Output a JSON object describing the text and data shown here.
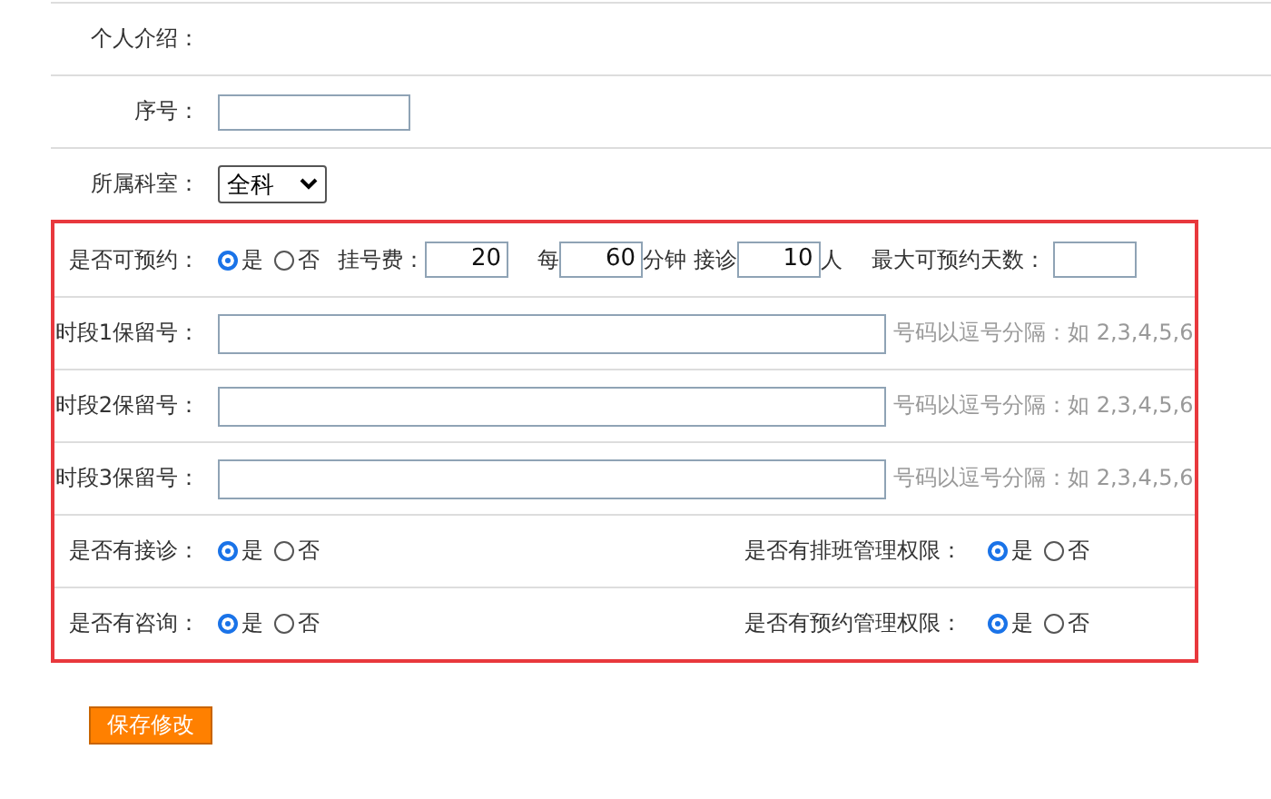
{
  "top_rows": [
    {
      "kind": "text",
      "label": "个人介绍："
    },
    {
      "kind": "input",
      "label": "序号："
    },
    {
      "kind": "select",
      "label": "所属科室：",
      "value": "全科"
    }
  ],
  "booking": {
    "label": "是否可预约：",
    "options": [
      {
        "label": "是",
        "selected": true
      },
      {
        "label": "否",
        "selected": false
      }
    ],
    "fee_label": "挂号费：",
    "fee": "20",
    "per_label": "每",
    "minutes": "60",
    "minutes_label": "分钟 接诊",
    "patients": "10",
    "patients_label": "人",
    "max_days_label": "最大可预约天数："
  },
  "reserve_rows": [
    {
      "label": "时段1保留号：",
      "hint": "号码以逗号分隔：如 2,3,4,5,6"
    },
    {
      "label": "时段2保留号：",
      "hint": "号码以逗号分隔：如 2,3,4,5,6"
    },
    {
      "label": "时段3保留号：",
      "hint": "号码以逗号分隔：如 2,3,4,5,6"
    }
  ],
  "permission_rows": [
    [
      {
        "label": "是否有接诊：",
        "options": [
          {
            "label": "是",
            "selected": true
          },
          {
            "label": "否",
            "selected": false
          }
        ]
      },
      {
        "label": "是否有排班管理权限：",
        "options": [
          {
            "label": "是",
            "selected": true
          },
          {
            "label": "否",
            "selected": false
          }
        ]
      }
    ],
    [
      {
        "label": "是否有咨询：",
        "options": [
          {
            "label": "是",
            "selected": true
          },
          {
            "label": "否",
            "selected": false
          }
        ]
      },
      {
        "label": "是否有预约管理权限：",
        "options": [
          {
            "label": "是",
            "selected": true
          },
          {
            "label": "否",
            "selected": false
          }
        ]
      }
    ]
  ],
  "save_button": "保存修改"
}
